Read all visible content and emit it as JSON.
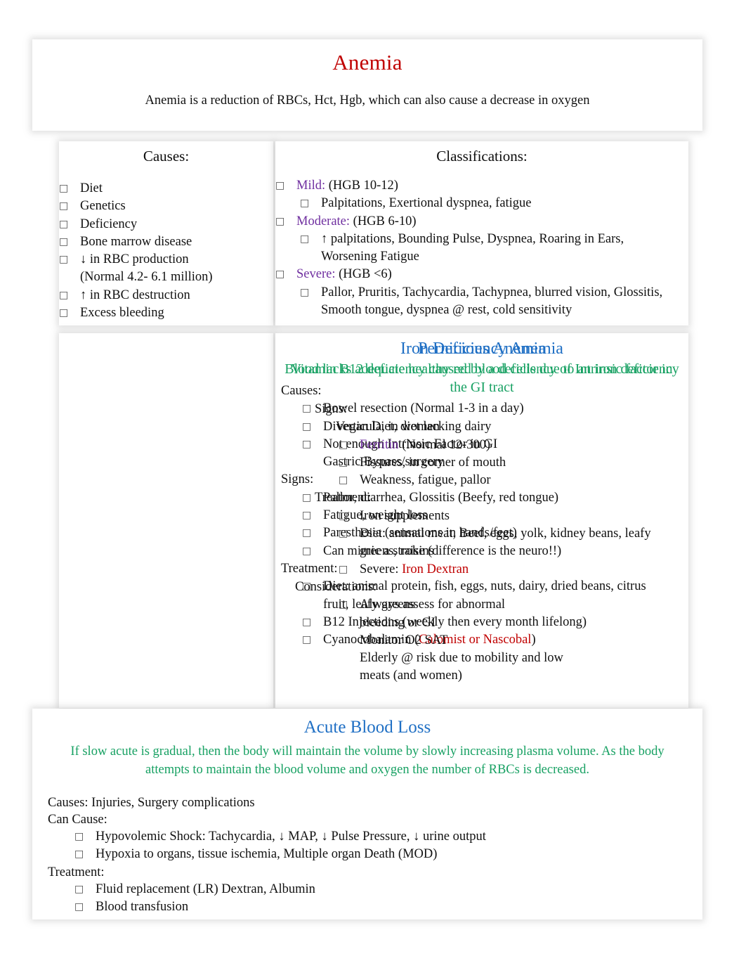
{
  "title": {
    "heading": "Anemia",
    "subtitle": "Anemia is a reduction of RBCs, Hct, Hgb, which can also cause a decrease in oxygen",
    "heading_color": "#C00000"
  },
  "causes": {
    "heading": "Causes:",
    "items": [
      "Diet",
      "Genetics",
      "Deficiency",
      "Bone marrow disease",
      "↓ in RBC production (Normal 4.2- 6.1 million)",
      "↑ in RBC destruction",
      "Excess bleeding"
    ]
  },
  "classifications": {
    "heading": "Classifications:",
    "accent_color": "#7030A0",
    "groups": [
      {
        "label": "Mild:",
        "range": "(HGB 10-12)",
        "signs": "Palpitations, Exertional dyspnea, fatigue"
      },
      {
        "label": "Moderate:",
        "range": " (HGB 6-10)",
        "signs": "↑ palpitations, Bounding Pulse, Dyspnea, Roaring in Ears, Worsening Fatigue"
      },
      {
        "label": "Severe:",
        "range": "(HGB <6)",
        "signs": "Pallor, Pruritis, Tachycardia, Tachypnea, blurred vision, Glossitis, Smooth tongue, dyspnea @ rest, cold sensitivity"
      }
    ]
  },
  "iron_deficiency": {
    "title": "Iron Deficiency Anemia",
    "title_color": "#1F6FC4",
    "subtitle": "Blood lacks adequate healthy red blood cells due to an iron deficiency",
    "subtitle_color": "#18A163",
    "causes_label": "Causes:",
    "causes": [
      "Bowel resection (Normal 1-3 in a day)",
      "Diverticula, in women",
      "Not enough Intrinsic Factor in GI",
      "Gastric Bypass/surgery"
    ],
    "signs_label": "Signs:",
    "signs": [
      "Pallor, diarrhea, Glossitis (Beefy, red tongue)",
      "Fatigue, weight loss",
      "Paresthesia (sensations in hands/feet)",
      "Can mimic a stroke (difference is the neuro!!)"
    ],
    "treatment_label": "Treatment:",
    "treatment": [
      "Diet: animal protein, fish, eggs, nuts, dairy, dried beans, citrus fruit, leafy greens",
      "B12 Injections (weekly then every month lifelong)",
      "Cyanocobalamin (Calomist or Nascobal)"
    ],
    "treatment_highlight": "Calomist or Nascobal",
    "highlight_color": "#C00000"
  },
  "pernicious": {
    "title": "Pernicious Anemia",
    "title_color": "#1F6FC4",
    "subtitle": "Vitamin B12 deficiency caused by a deficiency of Intrinsic factor in the GI tract",
    "subtitle_color": "#18A163",
    "signs_label": "Signs:",
    "signs": [
      "Vegan Diet, diet lacking dairy",
      "Ferritin (Normal 12-300)",
      "Fissures, in corner of mouth",
      "Weakness, fatigue, pallor"
    ],
    "signs_highlight": "Ferritin",
    "highlight_color": "#7030A0",
    "treatment_label": "Treatment:",
    "treatment": [
      "Iron supplements",
      "Diet: animal meat, Beef, eggs, yolk, kidney beans, leafy greens, raisins",
      "Severe: Iron Dextran"
    ],
    "treatment_highlight": "Iron Dextran",
    "treatment_highlight_color": "#C00000",
    "considerations_label": "Considerations:",
    "considerations": [
      "Always assess for abnormal bleeding or GI",
      "Monitor O2 SAT",
      "Elderly @ risk due to mobility and low meats (and women)"
    ]
  },
  "acute_blood_loss": {
    "title": "Acute Blood Loss",
    "title_color": "#1F6FC4",
    "subtitle": "If slow acute is gradual, then the body will maintain the volume by slowly increasing plasma volume. As the body attempts to maintain the blood volume and oxygen the number of RBCs is decreased.",
    "subtitle_color": "#18A163",
    "causes_line": "Causes: Injuries, Surgery complications",
    "can_cause_label": "Can Cause:",
    "can_cause": [
      "Hypovolemic Shock: Tachycardia, ↓ MAP, ↓ Pulse Pressure, ↓ urine output",
      "Hypoxia to organs, tissue ischemia, Multiple organ Death (MOD)"
    ],
    "treatment_label": "Treatment:",
    "treatment": [
      "Fluid replacement (LR) Dextran, Albumin",
      "Blood transfusion"
    ]
  }
}
